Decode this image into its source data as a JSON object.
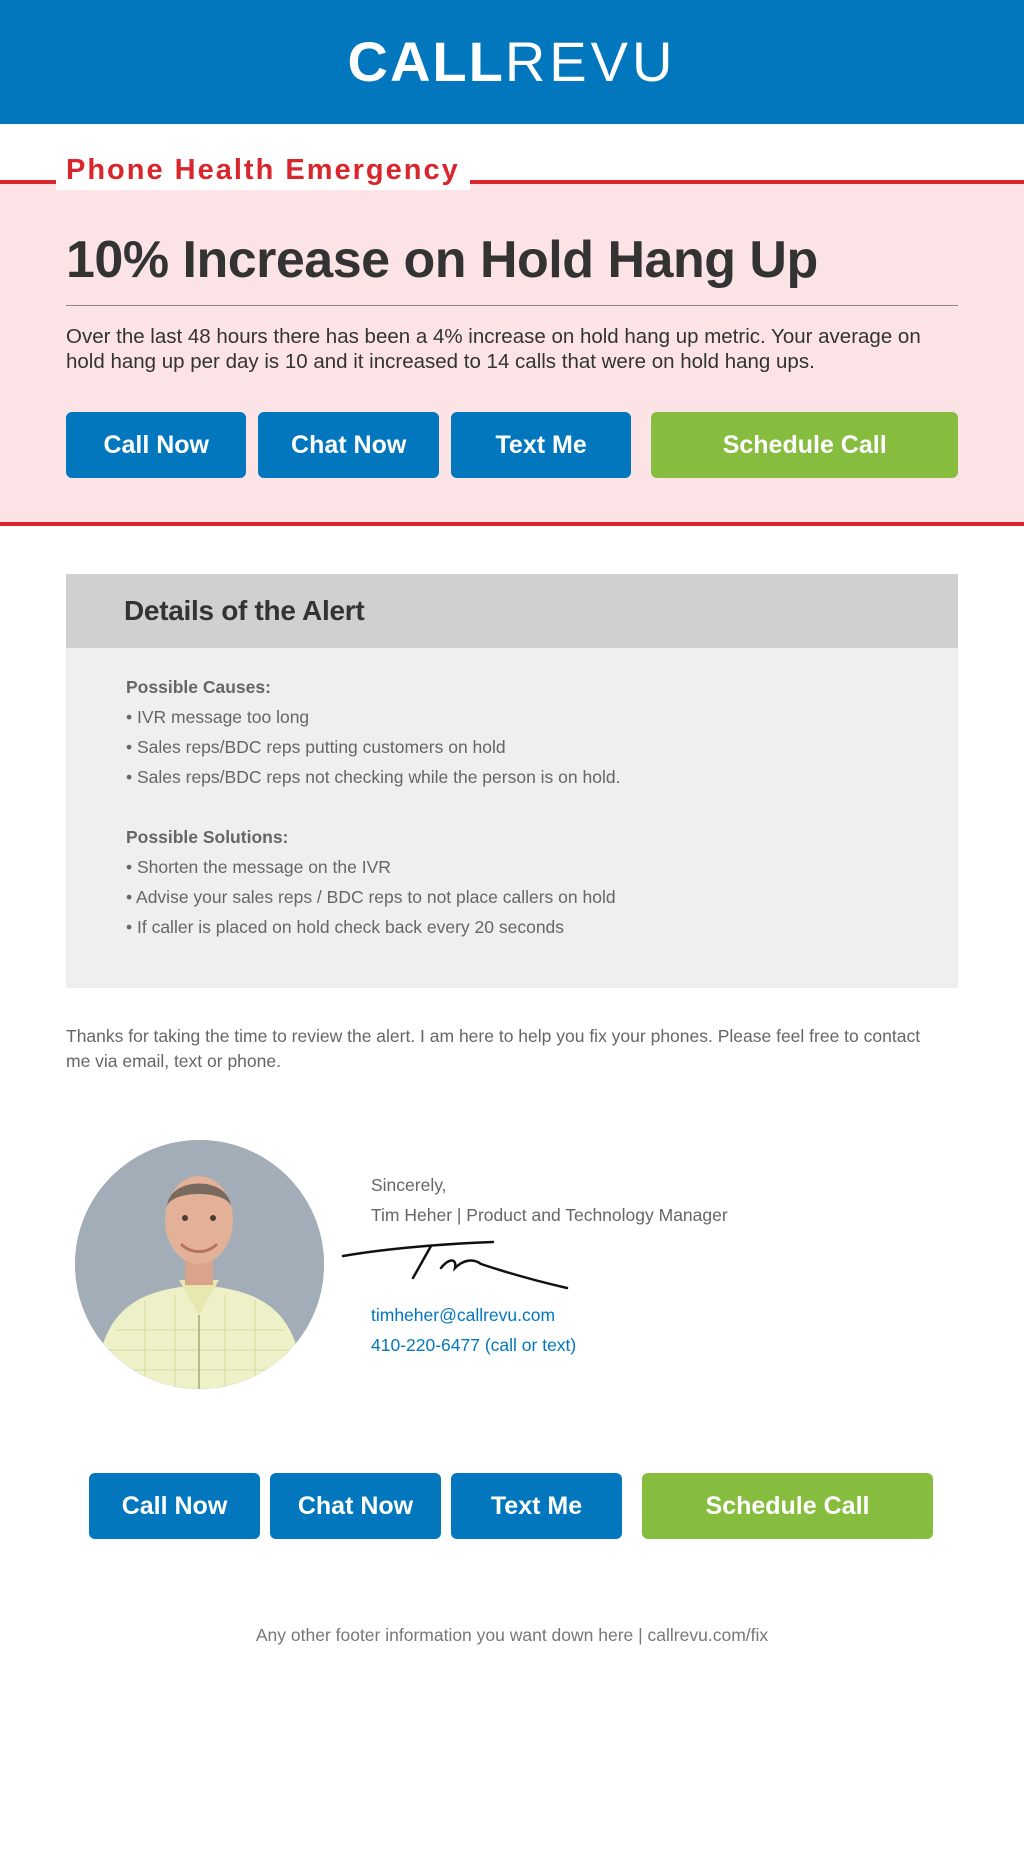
{
  "header": {
    "logo_bold": "CALL",
    "logo_light": "REVU"
  },
  "alert": {
    "label": "Phone Health Emergency",
    "headline": "10% Increase on Hold Hang Up",
    "summary": "Over the last 48 hours there has been a 4% increase on hold hang up metric.  Your average on hold hang up per day is 10 and it increased to 14 calls that were on hold hang ups.",
    "colors": {
      "accent_red": "#d9262c",
      "band_bg": "#fce4e6"
    }
  },
  "actions": {
    "call_now": "Call Now",
    "chat_now": "Chat Now",
    "text_me": "Text Me",
    "schedule_call": "Schedule Call",
    "colors": {
      "primary_blue": "#0277bd",
      "schedule_green": "#86bd3e"
    }
  },
  "details": {
    "title": "Details of the Alert",
    "causes_title": "Possible Causes:",
    "causes": [
      "• IVR message too long",
      "• Sales reps/BDC reps putting customers on hold",
      "• Sales reps/BDC reps not checking while the person is on hold."
    ],
    "solutions_title": "Possible Solutions:",
    "solutions": [
      "• Shorten the message on the IVR",
      "• Advise your sales reps / BDC reps to not place callers on hold",
      "• If caller is placed on hold check back every 20 seconds"
    ]
  },
  "thanks": "Thanks for taking the time to review the alert.  I am here to help you fix your phones.  Please feel free to contact me via email, text or phone.",
  "signature": {
    "closing": "Sincerely,",
    "name_title": "Tim Heher  |  Product and Technology Manager",
    "email": "timheher@callrevu.com",
    "phone": "410-220-6477 (call or text)",
    "avatar_icon": "person-photo"
  },
  "footer": {
    "text": "Any other footer information you want down here  |  callrevu.com/fix"
  }
}
